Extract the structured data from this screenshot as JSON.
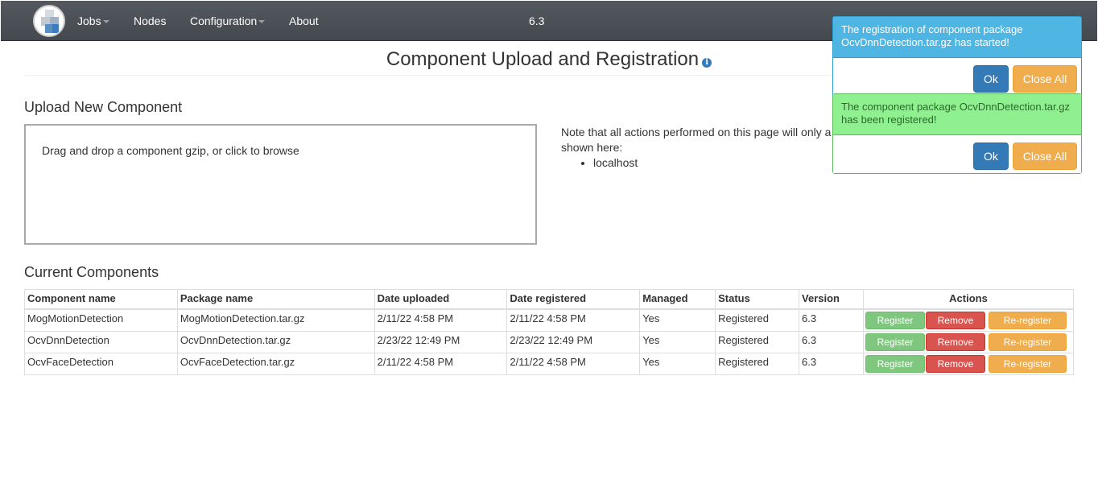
{
  "nav": {
    "items": [
      {
        "label": "Jobs",
        "dropdown": true
      },
      {
        "label": "Nodes",
        "dropdown": false
      },
      {
        "label": "Configuration",
        "dropdown": true
      },
      {
        "label": "About",
        "dropdown": false
      }
    ],
    "version": "6.3"
  },
  "page": {
    "title": "Component Upload and Registration",
    "info_icon": "i"
  },
  "upload": {
    "heading": "Upload New Component",
    "dropzone_text": "Drag and drop a component gzip, or click to browse",
    "note_text": "Note that all actions performed on this page will only a",
    "note_text2": "shown here:",
    "hosts": [
      "localhost"
    ]
  },
  "components": {
    "heading": "Current Components",
    "columns": [
      "Component name",
      "Package name",
      "Date uploaded",
      "Date registered",
      "Managed",
      "Status",
      "Version",
      "Actions"
    ],
    "rows": [
      {
        "name": "MogMotionDetection",
        "package": "MogMotionDetection.tar.gz",
        "uploaded": "2/11/22 4:58 PM",
        "registered": "2/11/22 4:58 PM",
        "managed": "Yes",
        "status": "Registered",
        "version": "6.3"
      },
      {
        "name": "OcvDnnDetection",
        "package": "OcvDnnDetection.tar.gz",
        "uploaded": "2/23/22 12:49 PM",
        "registered": "2/23/22 12:49 PM",
        "managed": "Yes",
        "status": "Registered",
        "version": "6.3"
      },
      {
        "name": "OcvFaceDetection",
        "package": "OcvFaceDetection.tar.gz",
        "uploaded": "2/11/22 4:58 PM",
        "registered": "2/11/22 4:58 PM",
        "managed": "Yes",
        "status": "Registered",
        "version": "6.3"
      }
    ],
    "actions": {
      "register": "Register",
      "remove": "Remove",
      "reregister": "Re-register"
    }
  },
  "notifications": [
    {
      "type": "info",
      "message": "The registration of component package OcvDnnDetection.tar.gz has started!",
      "ok": "Ok",
      "close_all": "Close All"
    },
    {
      "type": "success",
      "message": "The component package OcvDnnDetection.tar.gz has been registered!",
      "ok": "Ok",
      "close_all": "Close All"
    }
  ],
  "colors": {
    "navbar": "#4b5055",
    "primary": "#337ab7",
    "danger": "#d9534f",
    "warning": "#f0ad4e",
    "success_light": "#7fc77f",
    "info_bg": "#4fb6e3",
    "success_bg": "#8ff08f"
  }
}
